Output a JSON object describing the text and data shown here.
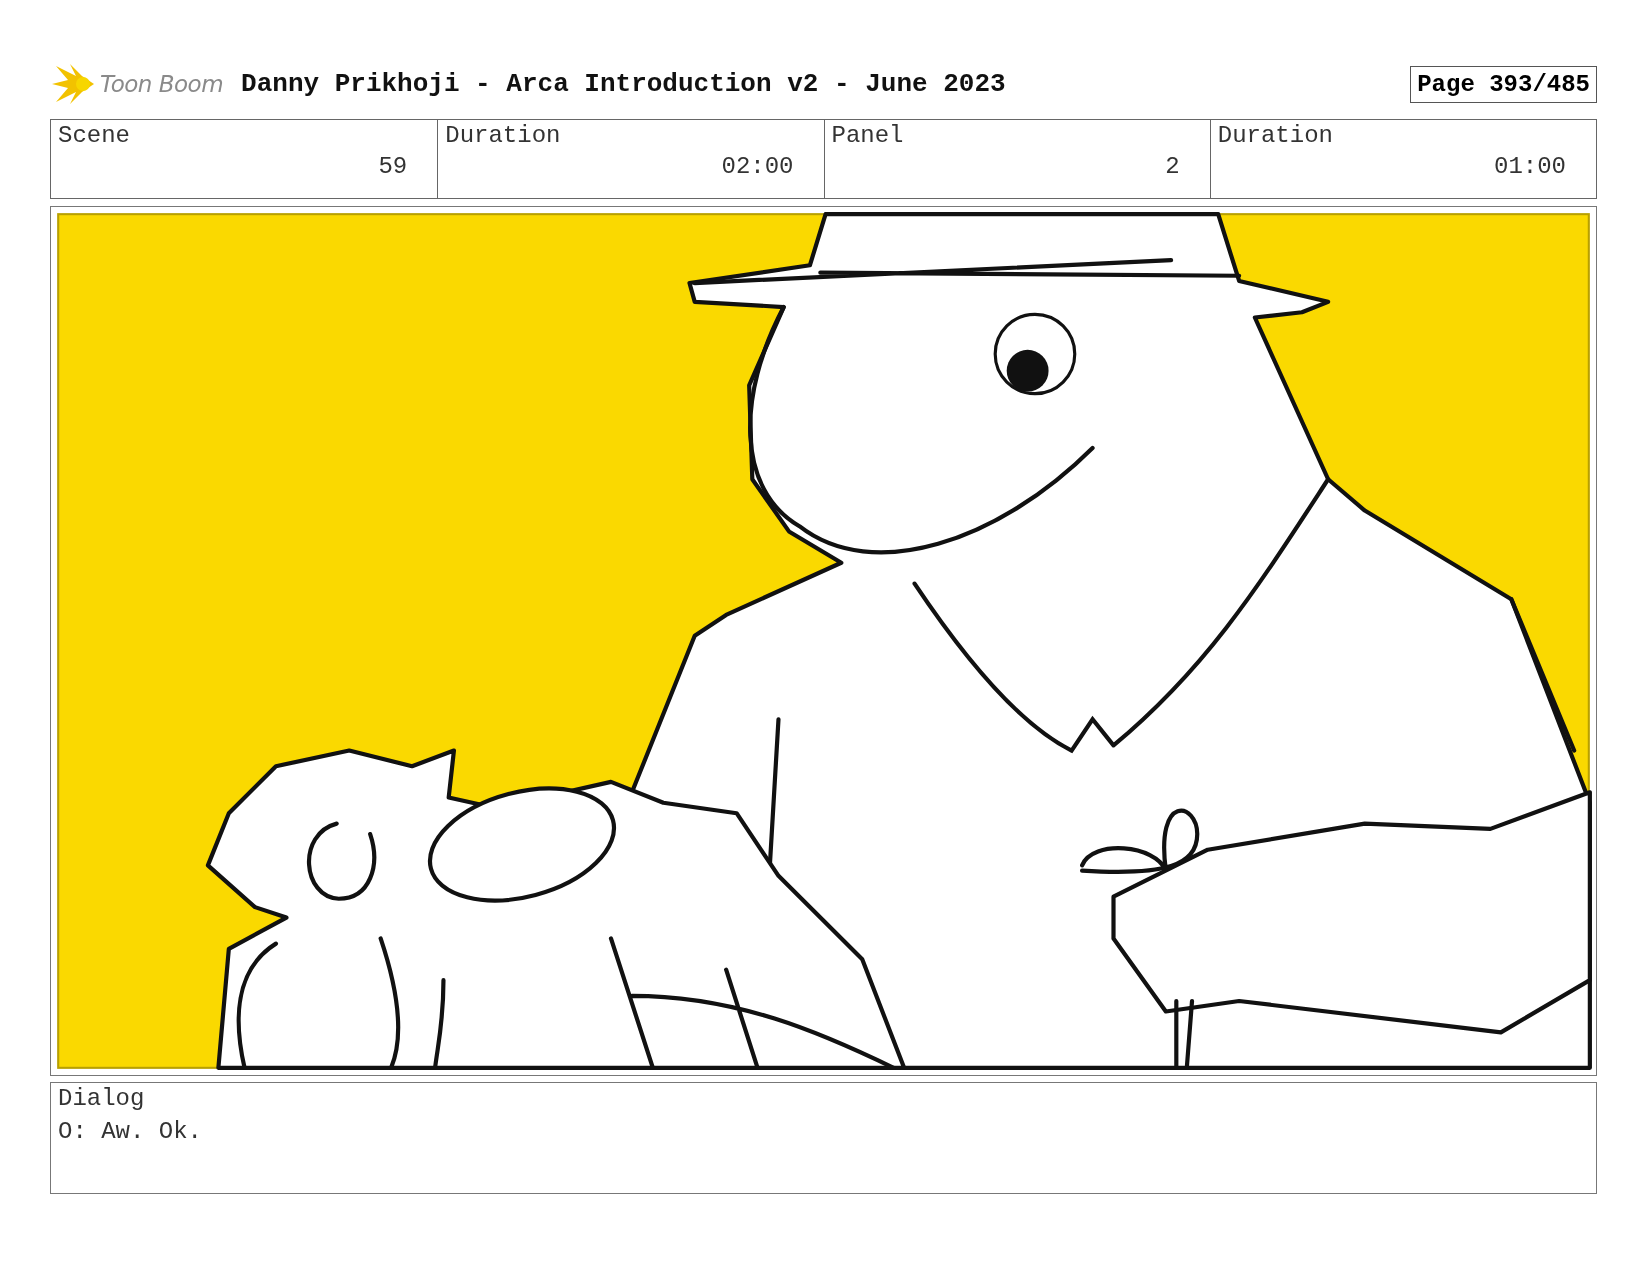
{
  "header": {
    "logo": "Toon Boom",
    "title": "Danny Prikhoji - Arca Introduction v2 - June 2023",
    "page": "Page 393/485"
  },
  "info": [
    {
      "label": "Scene",
      "value": "59"
    },
    {
      "label": "Duration",
      "value": "02:00"
    },
    {
      "label": "Panel",
      "value": "2"
    },
    {
      "label": "Duration",
      "value": "01:00"
    }
  ],
  "panel": {
    "kind": "sketch"
  },
  "dialog": {
    "label": "Dialog",
    "text": "O: Aw. Ok."
  }
}
